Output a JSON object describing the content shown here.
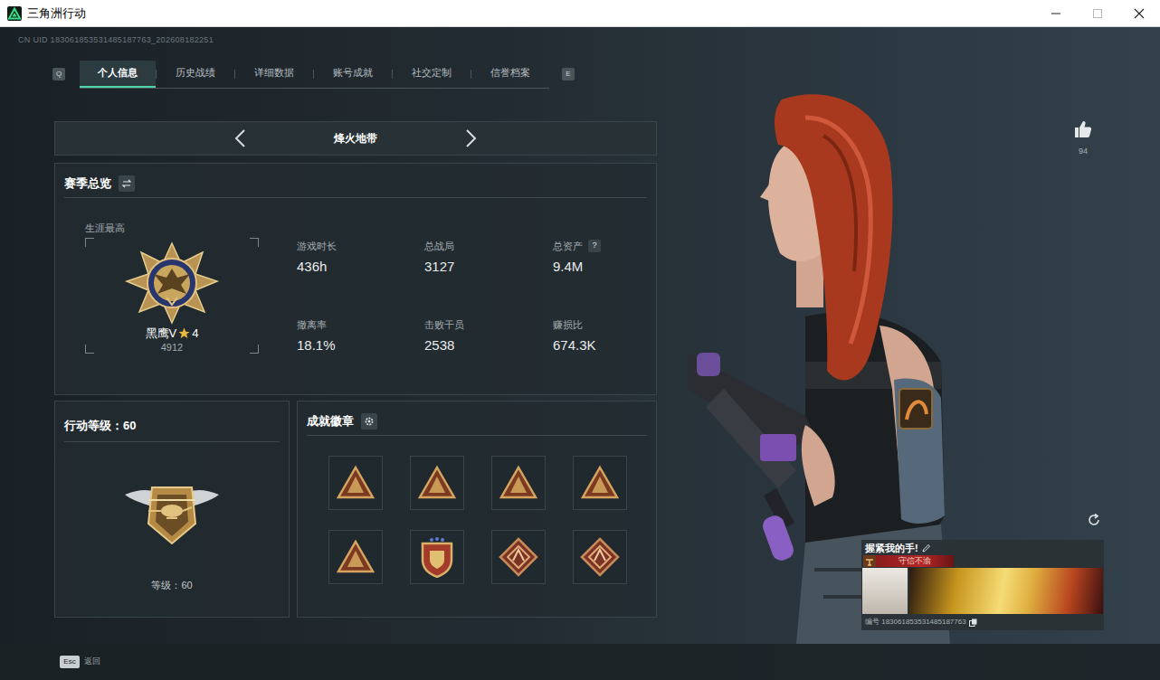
{
  "window": {
    "title": "三角洲行动"
  },
  "uid": "CN UID 183061853531485187763_202608182251",
  "tab_keys": {
    "prev": "Q",
    "next": "E"
  },
  "tabs": [
    {
      "label": "个人信息",
      "selected": true
    },
    {
      "label": "历史战绩",
      "selected": false
    },
    {
      "label": "详细数据",
      "selected": false
    },
    {
      "label": "账号成就",
      "selected": false
    },
    {
      "label": "社交定制",
      "selected": false
    },
    {
      "label": "信誉档案",
      "selected": false
    }
  ],
  "mode": {
    "label": "烽火地带"
  },
  "season": {
    "title": "赛季总览",
    "career_label": "生涯最高",
    "rank": "黑鹰V",
    "rank_star_count": "4",
    "score": "4912",
    "stats": [
      {
        "label": "游戏时长",
        "value": "436h"
      },
      {
        "label": "总战局",
        "value": "3127"
      },
      {
        "label": "总资产",
        "value": "9.4M",
        "hint": "?"
      },
      {
        "label": "撤离率",
        "value": "18.1%"
      },
      {
        "label": "击败干员",
        "value": "2538"
      },
      {
        "label": "赚损比",
        "value": "674.3K"
      }
    ]
  },
  "level": {
    "title": "行动等级：60",
    "label": "等级：60"
  },
  "badges": {
    "title": "成就徽章",
    "items": [
      {
        "kind": "triangle"
      },
      {
        "kind": "triangle"
      },
      {
        "kind": "triangle"
      },
      {
        "kind": "triangle"
      },
      {
        "kind": "triangle"
      },
      {
        "kind": "shield"
      },
      {
        "kind": "diamond"
      },
      {
        "kind": "diamond"
      }
    ]
  },
  "likes": {
    "count": "94"
  },
  "card": {
    "name": "握紧我的手!",
    "tag": "守信不渝",
    "id_label": "编号 183061853531485187763"
  },
  "footer": {
    "key": "Esc",
    "label": "返回"
  }
}
